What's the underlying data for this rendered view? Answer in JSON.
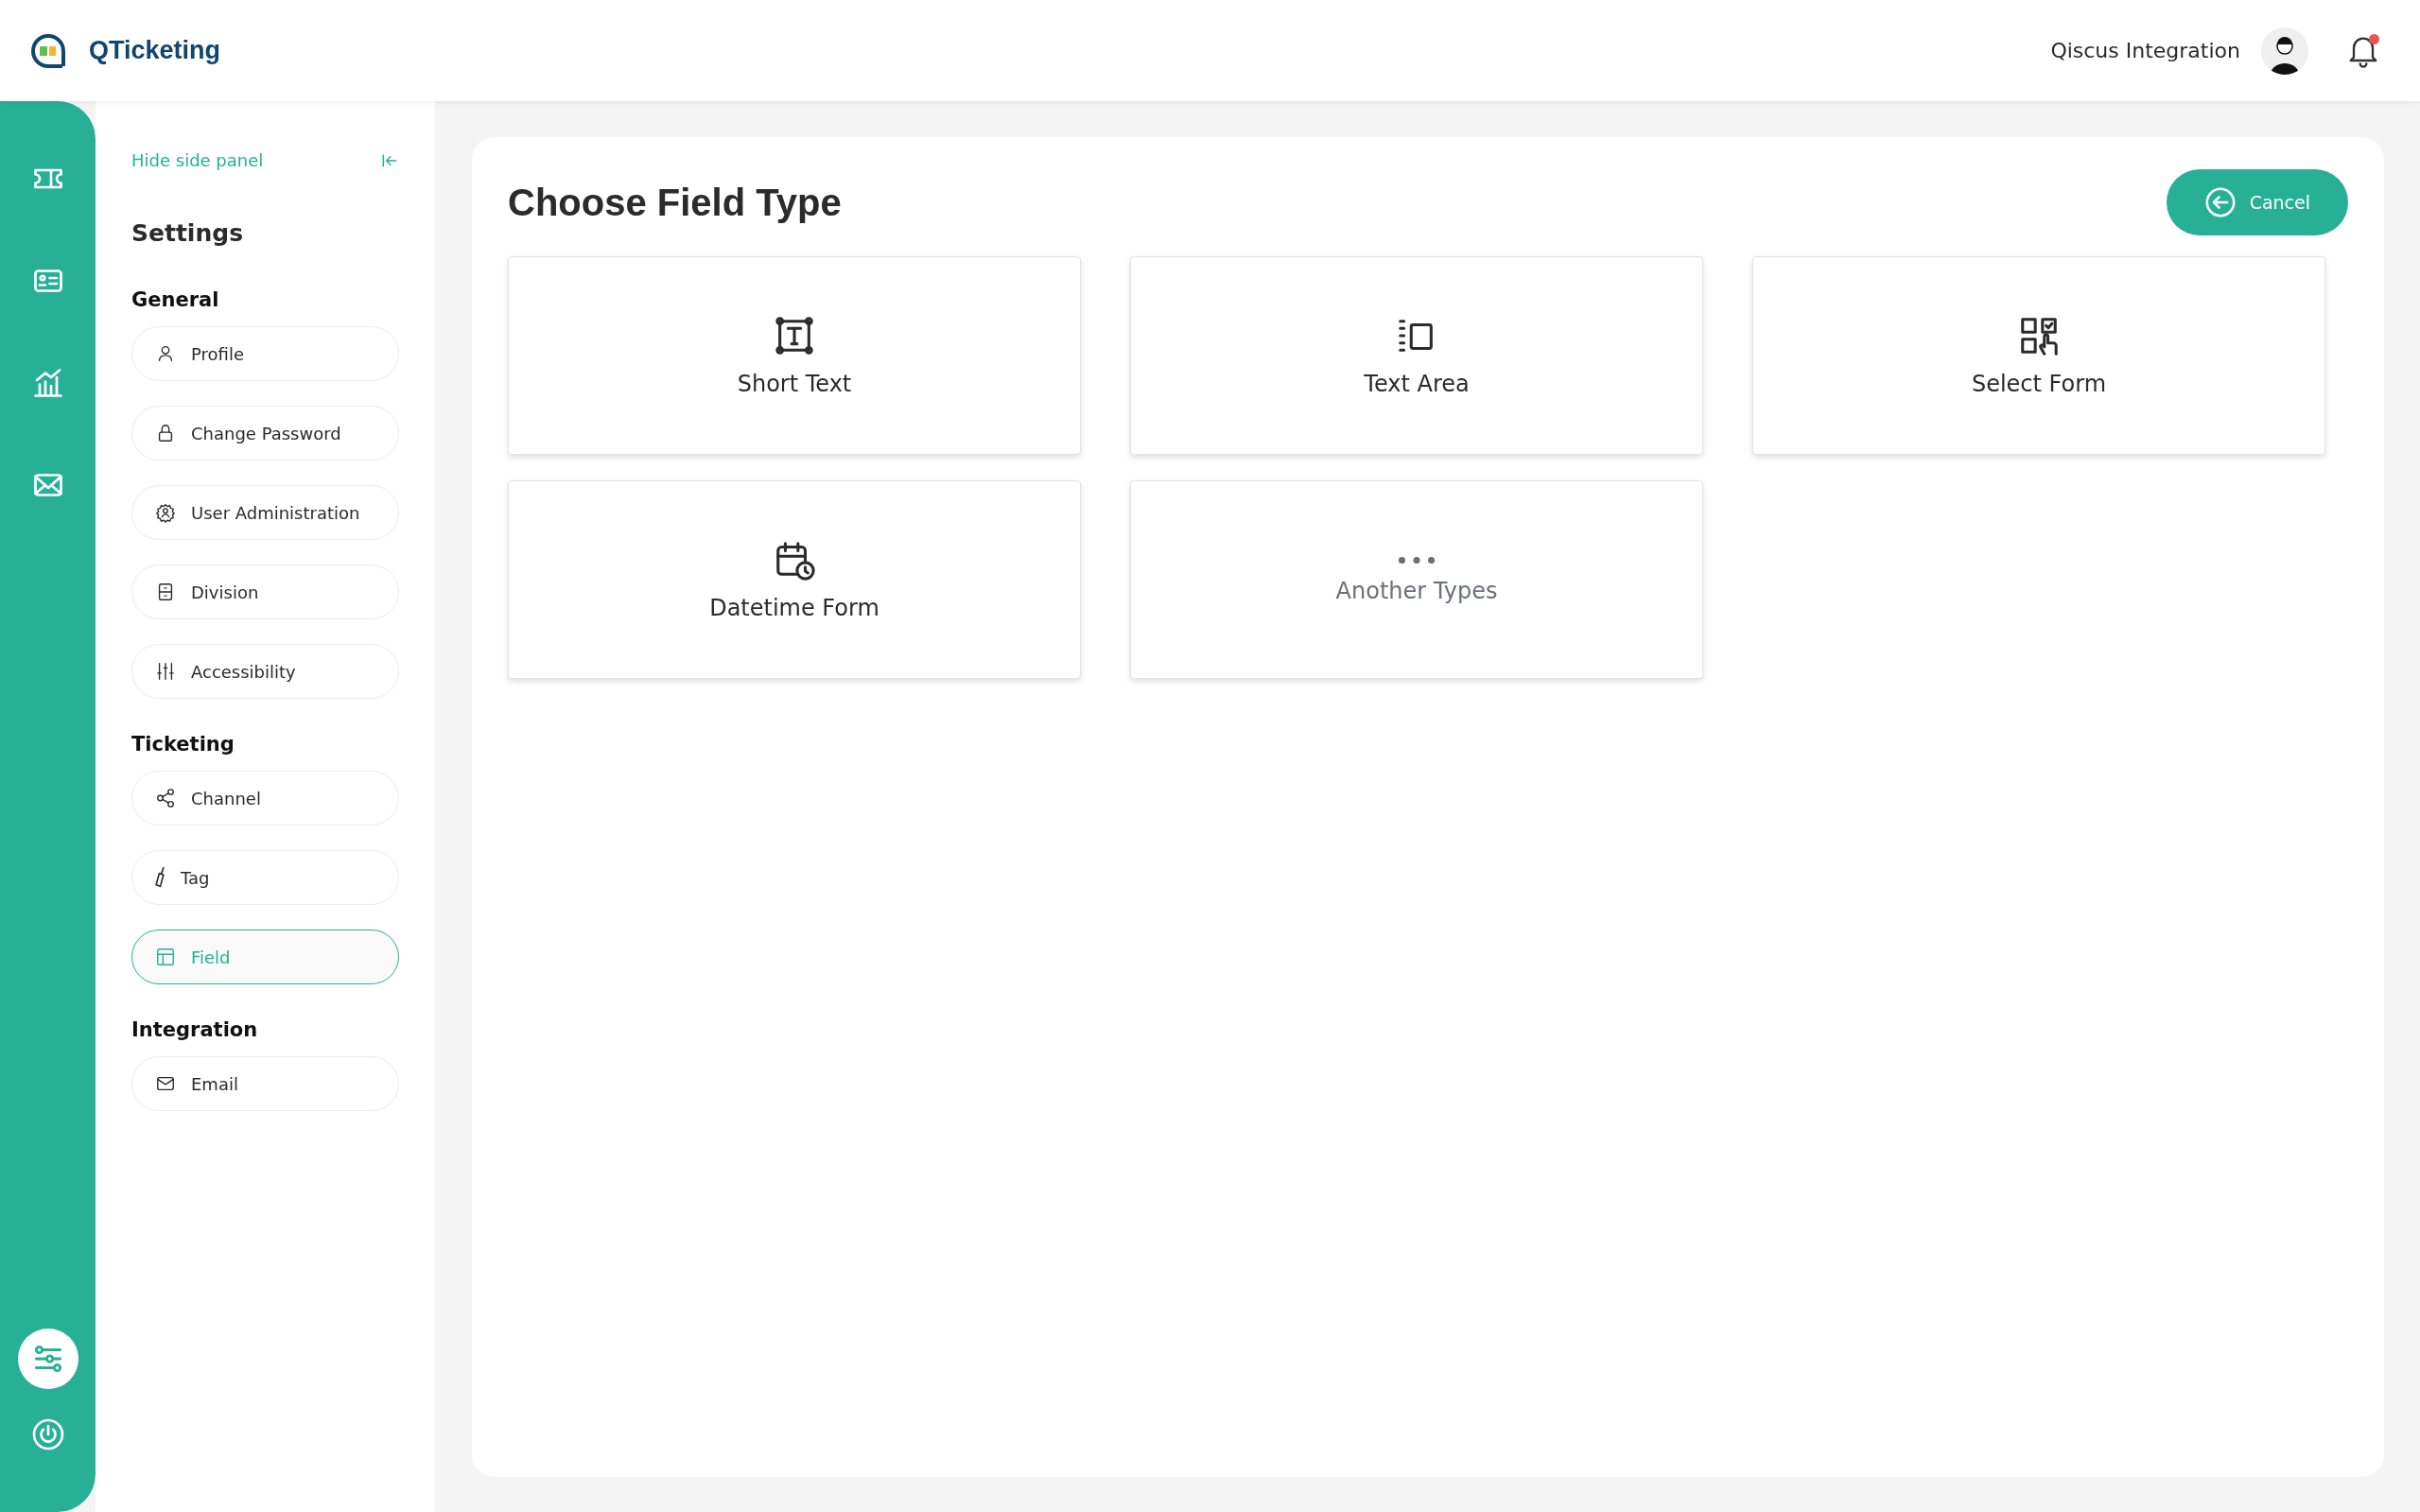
{
  "header": {
    "app_name": "QTicketing",
    "user_name": "Qiscus Integration",
    "notifications_unread": true
  },
  "rail": {
    "top_items": [
      {
        "kind": "ticket",
        "selected": false
      },
      {
        "kind": "contact-card",
        "selected": false
      },
      {
        "kind": "chart",
        "selected": false
      },
      {
        "kind": "mail",
        "selected": false
      }
    ],
    "bottom_items": [
      {
        "kind": "sliders",
        "selected": true
      },
      {
        "kind": "power",
        "selected": false
      }
    ]
  },
  "side_panel": {
    "hide_link": "Hide side panel",
    "title": "Settings",
    "sections": [
      {
        "title": "General",
        "items": [
          {
            "label": "Profile",
            "kind": "person",
            "selected": false
          },
          {
            "label": "Change Password",
            "kind": "lock",
            "selected": false
          },
          {
            "label": "User Administration",
            "kind": "user-gear",
            "selected": false
          },
          {
            "label": "Division",
            "kind": "cabinet",
            "selected": false
          },
          {
            "label": "Accessibility",
            "kind": "sliders-v",
            "selected": false
          }
        ]
      },
      {
        "title": "Ticketing",
        "items": [
          {
            "label": "Channel",
            "kind": "share",
            "selected": false
          },
          {
            "label": "Tag",
            "kind": "tag",
            "selected": false
          },
          {
            "label": "Field",
            "kind": "layout",
            "selected": true
          }
        ]
      },
      {
        "title": "Integration",
        "items": [
          {
            "label": "Email",
            "kind": "envelope",
            "selected": false
          }
        ]
      }
    ]
  },
  "main": {
    "title": "Choose Field Type",
    "cancel_button": "Cancel",
    "field_types": [
      {
        "label": "Short Text",
        "kind": "short-text"
      },
      {
        "label": "Text Area",
        "kind": "text-area"
      },
      {
        "label": "Select Form",
        "kind": "select-form"
      },
      {
        "label": "Datetime Form",
        "kind": "datetime"
      },
      {
        "label": "Another Types",
        "kind": "more"
      }
    ]
  }
}
